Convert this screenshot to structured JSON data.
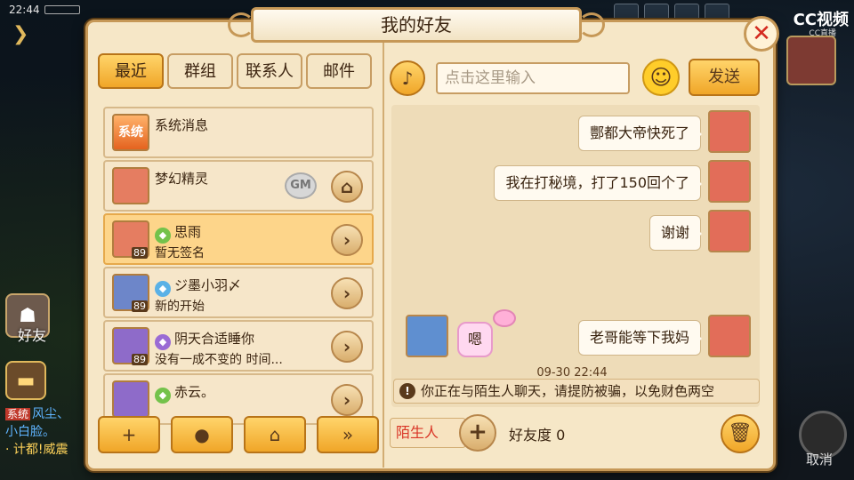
{
  "status_bar": {
    "time": "22:44"
  },
  "window": {
    "title": "我的好友",
    "close_icon": "close-icon"
  },
  "tabs": [
    {
      "label": "最近",
      "active": true
    },
    {
      "label": "群组",
      "active": false
    },
    {
      "label": "联系人",
      "active": false
    },
    {
      "label": "邮件",
      "active": false
    }
  ],
  "friends": [
    {
      "name": "系统消息",
      "subtitle": "",
      "avatar_text": "系统",
      "level": ""
    },
    {
      "name": "梦幻精灵",
      "subtitle": "",
      "badge": "GM",
      "level": ""
    },
    {
      "name": "思雨",
      "subtitle": "暂无签名",
      "level": "89"
    },
    {
      "name": "ジ墨小羽〆",
      "subtitle": "新的开始",
      "level": "89"
    },
    {
      "name": "阴天合适睡你",
      "subtitle": "没有一成不变的 时间...",
      "level": "89"
    },
    {
      "name": "赤云。",
      "subtitle": "",
      "level": ""
    }
  ],
  "chat": {
    "input_placeholder": "点击这里输入",
    "send_label": "发送",
    "messages": [
      {
        "side": "right",
        "text": "酆都大帝快死了"
      },
      {
        "side": "right",
        "text": "我在打秘境，打了150回个了"
      },
      {
        "side": "right",
        "text": "谢谢"
      },
      {
        "side": "left",
        "text": "嗯"
      },
      {
        "side": "right",
        "text": "老哥能等下我妈"
      }
    ],
    "timestamp": "09-30 22:44",
    "warning": "你正在与陌生人聊天，请提防被骗，以免财色两空",
    "stranger_label": "陌生人",
    "favor_label": "好友度 0"
  },
  "game_hud": {
    "friends_label": "好友",
    "cancel_label": "取消",
    "chat_lines": [
      "系统",
      "风尘、",
      "小白脸。",
      "· 计都!威震"
    ],
    "stream_logo": "CC视频",
    "stream_sub": "CC直播"
  },
  "colors": {
    "accent": "#f0a628",
    "panel": "#f6e7c7",
    "border": "#c69857",
    "stranger": "#d93425"
  }
}
